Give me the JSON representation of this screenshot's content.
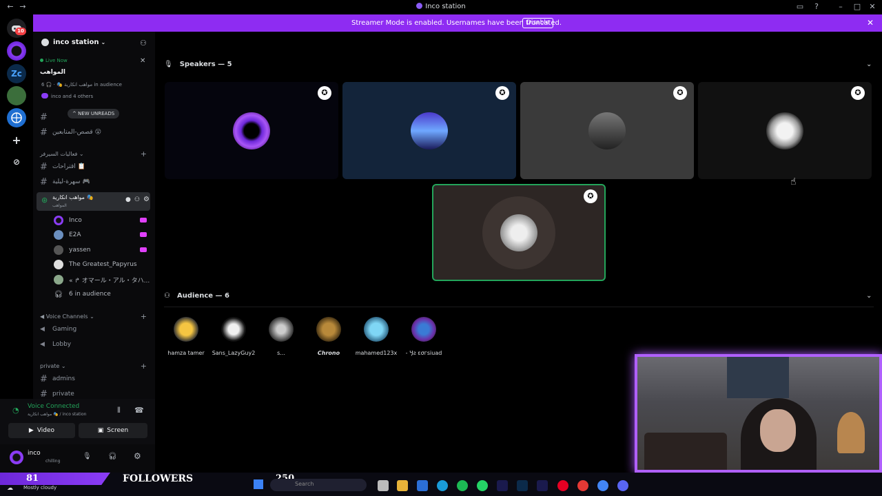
{
  "window": {
    "title": "Inco station"
  },
  "banner": {
    "message": "Streamer Mode is enabled. Usernames have been truncated.",
    "disable_label": "Disable"
  },
  "rail": {
    "badge": "10",
    "zc_label": "Zc"
  },
  "sidebar": {
    "server_name": "inco station",
    "live_label": "Live Now",
    "stage_title": "المواهب",
    "stage_sub": "مواهب انكارية 🎭 · 🎧 6 in audience",
    "stage_people": "inco and 4 others",
    "new_unreads": "NEW UNREADS",
    "channels_top": [
      "قصص-المتابعين 😮"
    ],
    "category_1": "فعاليات السيرفر",
    "channels_mid": [
      "اقتراحات 📋",
      "سهرة-ليلية 🎮"
    ],
    "active_stage": "مواهب انكارية 🎭",
    "active_stage_sub": "المواهب",
    "members": [
      "Inco",
      "E2A",
      "yassen",
      "The Greatest_Papyrus",
      "« ↱ オマール・アル・タハ..."
    ],
    "audience_count": "6 in audience",
    "category_2": "Voice Channels",
    "voice_channels": [
      "Gaming",
      "Lobby"
    ],
    "category_3": "private",
    "private_channels": [
      "admins",
      "private"
    ]
  },
  "voice": {
    "status": "Voice Connected",
    "location": "مواهب انكارية 🎭 / inco station",
    "video_label": "Video",
    "screen_label": "Screen",
    "user_name": "inco",
    "user_status": "chilling"
  },
  "main": {
    "speakers_heading": "Speakers — 5",
    "audience_heading": "Audience — 6",
    "audience": [
      "hamza tamer",
      "Sans_LazyGuy2",
      "s...",
      "Chrono",
      "mahamed123x",
      "- Ӌƨ εσгsiuad"
    ]
  },
  "overlay": {
    "followers_count": "81",
    "followers_label": "FOLLOWERS",
    "followers_goal": "250",
    "weather": "Mostly cloudy",
    "search_placeholder": "Search"
  },
  "colors": {
    "accent": "#8e2cf2",
    "live_green": "#23a55a",
    "speaking_border": "#23a55a"
  }
}
